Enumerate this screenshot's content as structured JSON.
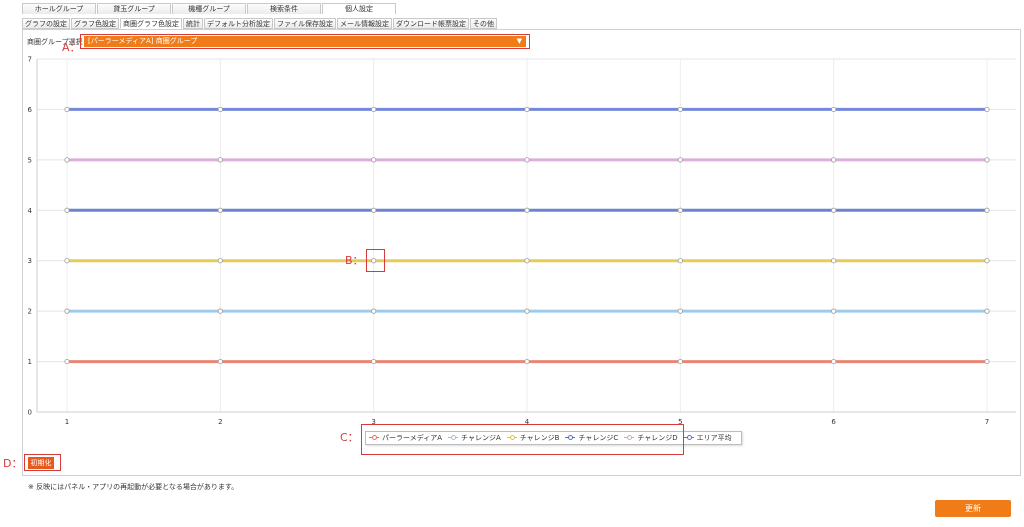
{
  "top_tabs": [
    "ホールグループ",
    "貸玉グループ",
    "機種グループ",
    "検索条件",
    "個人設定"
  ],
  "sub_tabs": [
    "グラフの設定",
    "グラフ色設定",
    "商圏グラフ色設定",
    "統計",
    "デフォルト分析設定",
    "ファイル保存設定",
    "メール情報設定",
    "ダウンロード帳票設定",
    "その他"
  ],
  "selector": {
    "label": "商圏グループ選択",
    "value": "[パーラーメディアA] 商圏グループ",
    "caret": "▼"
  },
  "annotations": {
    "a": "A：",
    "b": "B：",
    "c": "C：",
    "d": "D："
  },
  "buttons": {
    "reset": "初期化",
    "update": "更新"
  },
  "note": "※ 反映にはパネル・アプリの再起動が必要となる場合があります。",
  "chart_data": {
    "type": "line",
    "x": [
      1,
      2,
      3,
      4,
      5,
      6,
      7
    ],
    "xlim": [
      1,
      7
    ],
    "ylim": [
      0,
      7
    ],
    "yticks": [
      0,
      1,
      2,
      3,
      4,
      5,
      6,
      7
    ],
    "grid": true,
    "legend_position": "bottom",
    "series": [
      {
        "name": "パーラーメディアA",
        "color": "#e8735f",
        "values": [
          1,
          1,
          1,
          1,
          1,
          1,
          1
        ]
      },
      {
        "name": "チャレンジA",
        "color": "#8fc6e8",
        "values": [
          2,
          2,
          2,
          2,
          2,
          2,
          2
        ]
      },
      {
        "name": "チャレンジB",
        "color": "#e6c43c",
        "values": [
          3,
          3,
          3,
          3,
          3,
          3,
          3
        ]
      },
      {
        "name": "チャレンジC",
        "color": "#5570c9",
        "values": [
          4,
          4,
          4,
          4,
          4,
          4,
          4
        ]
      },
      {
        "name": "チャレンジD",
        "color": "#d7a3d6",
        "values": [
          5,
          5,
          5,
          5,
          5,
          5,
          5
        ]
      },
      {
        "name": "エリア平均",
        "color": "#5f74d6",
        "values": [
          6,
          6,
          6,
          6,
          6,
          6,
          6
        ]
      }
    ]
  }
}
